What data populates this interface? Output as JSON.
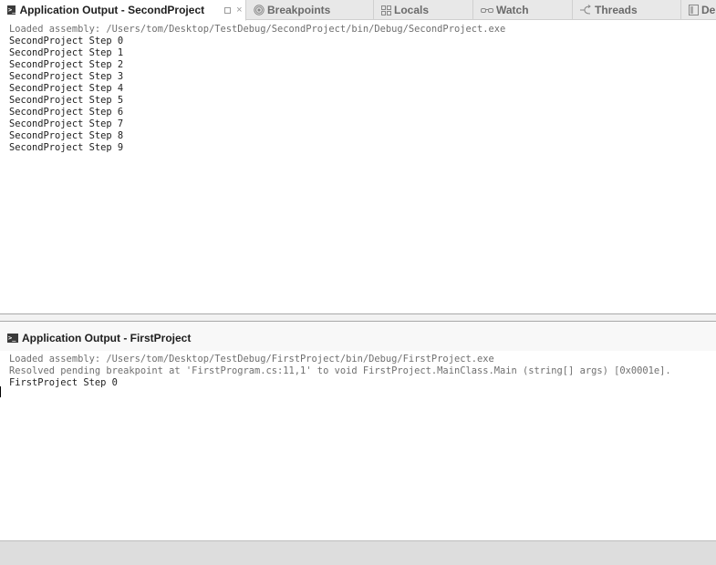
{
  "tabs": [
    {
      "label": "Application Output - SecondProject",
      "icon": "terminal-icon",
      "active": true
    },
    {
      "label": "Breakpoints",
      "icon": "breakpoints-icon",
      "active": false
    },
    {
      "label": "Locals",
      "icon": "locals-grid-icon",
      "active": false
    },
    {
      "label": "Watch",
      "icon": "glasses-icon",
      "active": false
    },
    {
      "label": "Threads",
      "icon": "threads-icon",
      "active": false
    },
    {
      "label": "De",
      "icon": "panel-icon",
      "active": false
    }
  ],
  "tab_actions": {
    "maximize_glyph": "",
    "close_glyph": "×"
  },
  "top_output": {
    "title": "Application Output - SecondProject",
    "loaded": "Loaded assembly: /Users/tom/Desktop/TestDebug/SecondProject/bin/Debug/SecondProject.exe",
    "lines": [
      "SecondProject Step 0",
      "SecondProject Step 1",
      "SecondProject Step 2",
      "SecondProject Step 3",
      "SecondProject Step 4",
      "SecondProject Step 5",
      "SecondProject Step 6",
      "SecondProject Step 7",
      "SecondProject Step 8",
      "SecondProject Step 9"
    ]
  },
  "bottom_output": {
    "title": "Application Output - FirstProject",
    "loaded": "Loaded assembly: /Users/tom/Desktop/TestDebug/FirstProject/bin/Debug/FirstProject.exe",
    "resolved": "Resolved pending breakpoint at 'FirstProgram.cs:11,1' to void FirstProject.MainClass.Main (string[] args) [0x0001e].",
    "lines": [
      "FirstProject Step 0"
    ]
  },
  "icons": {
    "terminal_glyph": ">_"
  }
}
